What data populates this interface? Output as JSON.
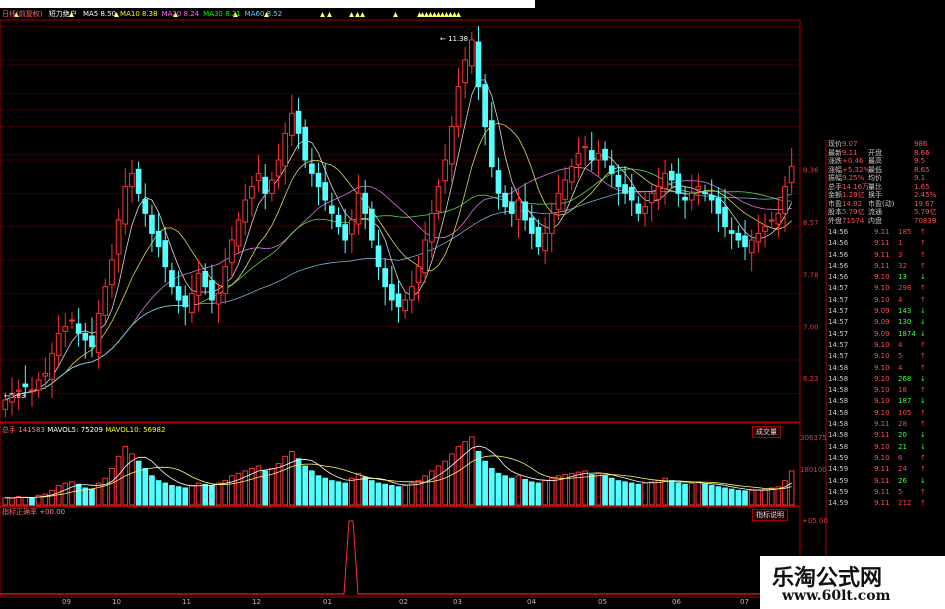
{
  "indicator_bar": {
    "title": "日线(前复权)",
    "formula": "短力绝户",
    "mas": [
      {
        "label": "MA5",
        "value": "8.50",
        "color": "#ffffff"
      },
      {
        "label": "MA10",
        "value": "8.38",
        "color": "#ffff00"
      },
      {
        "label": "MA20",
        "value": "8.24",
        "color": "#ff66ff"
      },
      {
        "label": "MA30",
        "value": "8.21",
        "color": "#00ff00"
      },
      {
        "label": "MA60",
        "value": "8.52",
        "color": "#66ccff"
      }
    ]
  },
  "price_axis": [
    "9.36",
    "8.57",
    "7.78",
    "7.00",
    "6.23"
  ],
  "peak_label": "11.38",
  "low_label": "5.83",
  "volume_bar": {
    "label": "总手",
    "total": "141583",
    "mavol5": "MAVOL5: 75209",
    "mavol10": "MAVOL10: 56982",
    "button": "成交量",
    "axis": [
      "306375",
      "180100"
    ]
  },
  "signal_bar": {
    "label": "指标正确率",
    "value": "+00.00",
    "button": "指标说明",
    "axis": "+05.00"
  },
  "x_labels": [
    "09",
    "10",
    "11",
    "12",
    "01",
    "02",
    "03",
    "04",
    "05",
    "06",
    "07"
  ],
  "quote": [
    {
      "l": "现价",
      "v": "9.07",
      "l2": "",
      "v2": "986"
    },
    {
      "l": "最新",
      "v": "9.11",
      "l2": "开盘",
      "v2": "8.66"
    },
    {
      "l": "涨跌",
      "v": "+0.46",
      "l2": "最高",
      "v2": "9.5"
    },
    {
      "l": "涨幅",
      "v": "+5.32%",
      "l2": "最低",
      "v2": "8.65"
    },
    {
      "l": "振幅",
      "v": "9.25%",
      "l2": "均价",
      "v2": "9.1"
    },
    {
      "l": "总手",
      "v": "14.16万",
      "l2": "量比",
      "v2": "1.65"
    },
    {
      "l": "金额",
      "v": "1.29亿",
      "l2": "换手",
      "v2": "2.45%"
    },
    {
      "l": "市盈",
      "v": "14.92",
      "l2": "市盈(动)",
      "v2": "19.67"
    },
    {
      "l": "股本",
      "v": "5.79亿",
      "l2": "流通",
      "v2": "5.79亿"
    },
    {
      "l": "外盘",
      "v": "71574",
      "l2": "内盘",
      "v2": "70839"
    }
  ],
  "trades": [
    {
      "t": "14:56",
      "p": "9.11",
      "q": "185",
      "d": "up"
    },
    {
      "t": "14:56",
      "p": "9.11",
      "q": "1",
      "d": "up"
    },
    {
      "t": "14:56",
      "p": "9.11",
      "q": "3",
      "d": "up"
    },
    {
      "t": "14:56",
      "p": "9.11",
      "q": "32",
      "d": "up"
    },
    {
      "t": "14:56",
      "p": "9.10",
      "q": "13",
      "d": "dn"
    },
    {
      "t": "14:57",
      "p": "9.10",
      "q": "298",
      "d": "up"
    },
    {
      "t": "14:57",
      "p": "9.10",
      "q": "4",
      "d": "up"
    },
    {
      "t": "14:57",
      "p": "9.09",
      "q": "143",
      "d": "dn"
    },
    {
      "t": "14:57",
      "p": "9.09",
      "q": "130",
      "d": "dn"
    },
    {
      "t": "14:57",
      "p": "9.09",
      "q": "1874",
      "d": "dn"
    },
    {
      "t": "14:57",
      "p": "9.10",
      "q": "4",
      "d": "up"
    },
    {
      "t": "14:57",
      "p": "9.10",
      "q": "5",
      "d": "up"
    },
    {
      "t": "14:58",
      "p": "9.10",
      "q": "4",
      "d": "up"
    },
    {
      "t": "14:58",
      "p": "9.10",
      "q": "268",
      "d": "dn"
    },
    {
      "t": "14:58",
      "p": "9.10",
      "q": "18",
      "d": "up"
    },
    {
      "t": "14:58",
      "p": "9.10",
      "q": "187",
      "d": "dn"
    },
    {
      "t": "14:58",
      "p": "9.10",
      "q": "105",
      "d": "up"
    },
    {
      "t": "14:58",
      "p": "9.11",
      "q": "28",
      "d": "up"
    },
    {
      "t": "14:58",
      "p": "9.11",
      "q": "20",
      "d": "dn"
    },
    {
      "t": "14:58",
      "p": "9.10",
      "q": "21",
      "d": "dn"
    },
    {
      "t": "14:59",
      "p": "9.10",
      "q": "6",
      "d": "up"
    },
    {
      "t": "14:59",
      "p": "9.11",
      "q": "24",
      "d": "up"
    },
    {
      "t": "14:59",
      "p": "9.11",
      "q": "26",
      "d": "dn"
    },
    {
      "t": "14:59",
      "p": "9.11",
      "q": "5",
      "d": "up"
    },
    {
      "t": "14:59",
      "p": "9.11",
      "q": "212",
      "d": "up"
    }
  ],
  "watermark": {
    "cn": "乐淘公式网",
    "url": "www.60lt.com"
  },
  "chart_data": {
    "type": "candlestick",
    "ylim": [
      5.6,
      11.6
    ],
    "closes": [
      5.9,
      6.0,
      6.05,
      6.1,
      6.05,
      6.2,
      6.3,
      6.6,
      6.9,
      7.0,
      7.1,
      6.9,
      6.8,
      6.7,
      7.2,
      7.6,
      8.0,
      8.6,
      9.1,
      9.3,
      9.0,
      8.7,
      8.4,
      8.2,
      7.9,
      7.6,
      7.4,
      7.3,
      7.5,
      7.8,
      7.6,
      7.4,
      7.5,
      7.9,
      8.3,
      8.6,
      8.9,
      9.1,
      9.3,
      9.0,
      9.2,
      9.5,
      9.9,
      10.2,
      9.9,
      9.5,
      9.3,
      9.1,
      8.9,
      8.7,
      8.5,
      8.3,
      8.6,
      9.0,
      8.7,
      8.3,
      7.9,
      7.6,
      7.4,
      7.3,
      7.4,
      7.6,
      7.9,
      8.3,
      8.7,
      9.1,
      9.5,
      10.0,
      10.6,
      11.0,
      11.3,
      10.6,
      10.0,
      9.4,
      9.0,
      8.8,
      8.7,
      8.9,
      8.6,
      8.4,
      8.2,
      8.4,
      8.7,
      9.0,
      9.2,
      9.4,
      9.6,
      9.7,
      9.5,
      9.6,
      9.5,
      9.3,
      9.1,
      9.0,
      8.9,
      8.7,
      8.8,
      9.0,
      9.1,
      9.3,
      9.2,
      9.0,
      8.9,
      9.0,
      9.1,
      9.0,
      8.9,
      8.7,
      8.5,
      8.4,
      8.3,
      8.2,
      8.3,
      8.4,
      8.5,
      8.6,
      8.7,
      9.1,
      9.4
    ],
    "volumes": [
      30,
      28,
      35,
      32,
      30,
      40,
      45,
      60,
      80,
      90,
      95,
      85,
      70,
      65,
      90,
      110,
      150,
      200,
      240,
      210,
      180,
      150,
      120,
      100,
      90,
      80,
      75,
      70,
      80,
      90,
      85,
      80,
      90,
      100,
      120,
      130,
      140,
      150,
      160,
      140,
      150,
      170,
      200,
      220,
      190,
      160,
      140,
      120,
      110,
      100,
      95,
      90,
      110,
      130,
      115,
      100,
      90,
      85,
      80,
      75,
      80,
      90,
      100,
      120,
      140,
      160,
      180,
      210,
      240,
      260,
      280,
      220,
      180,
      150,
      130,
      120,
      110,
      120,
      105,
      95,
      90,
      100,
      110,
      120,
      125,
      130,
      135,
      140,
      125,
      130,
      120,
      110,
      100,
      95,
      90,
      85,
      90,
      95,
      100,
      110,
      100,
      90,
      85,
      90,
      95,
      85,
      80,
      75,
      70,
      65,
      60,
      58,
      60,
      62,
      65,
      70,
      75,
      100,
      140
    ]
  }
}
